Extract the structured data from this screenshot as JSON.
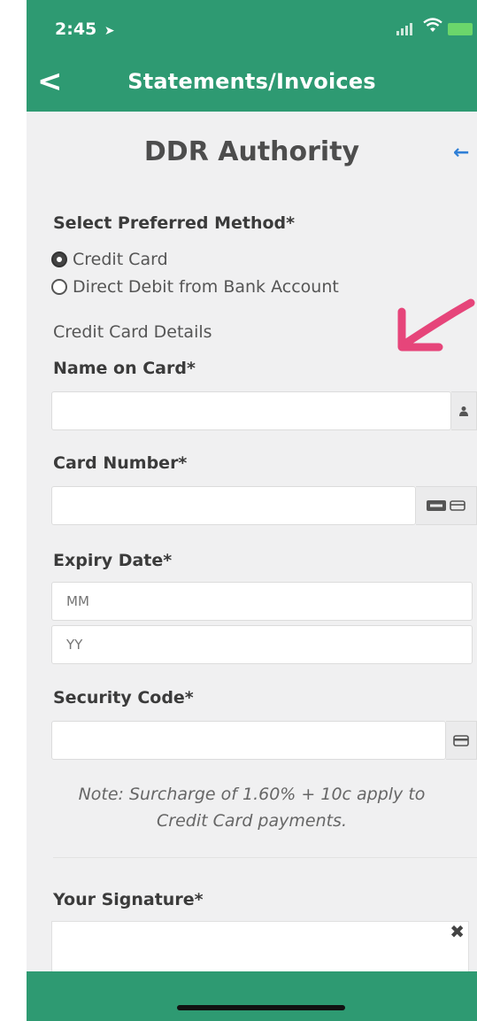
{
  "status_bar": {
    "time": "2:45",
    "location_icon": "location-arrow-icon",
    "signal_icon": "signal-bars-icon",
    "wifi_icon": "wifi-icon",
    "battery_icon": "battery-charging-icon"
  },
  "nav": {
    "back_icon": "chevron-left-icon",
    "title": "Statements/Invoices"
  },
  "page": {
    "title": "DDR Authority",
    "back_icon": "arrow-left-icon"
  },
  "method": {
    "label": "Select Preferred Method*",
    "options": [
      {
        "label": "Credit Card",
        "selected": true
      },
      {
        "label": "Direct Debit from Bank Account",
        "selected": false
      }
    ]
  },
  "card": {
    "section_label": "Credit Card Details",
    "name_label": "Name on Card*",
    "name_value": "",
    "name_icon": "user-icon",
    "number_label": "Card Number*",
    "number_value": "",
    "number_icon": "credit-card-brands-icon",
    "expiry_label": "Expiry Date*",
    "month_placeholder": "MM",
    "year_placeholder": "YY",
    "security_label": "Security Code*",
    "security_value": "",
    "security_icon": "credit-card-icon",
    "note_line1": "Note: Surcharge of 1.60% + 10c apply to",
    "note_line2": "Credit Card payments."
  },
  "signature": {
    "label": "Your Signature*",
    "clear_icon": "close-icon"
  },
  "annotation": {
    "arrow_icon": "pink-arrow-annotation-icon",
    "color": "#e6457a"
  },
  "colors": {
    "brand": "#2e9a72",
    "background": "#f0f0f1",
    "accent_blue": "#2f7fd6"
  }
}
